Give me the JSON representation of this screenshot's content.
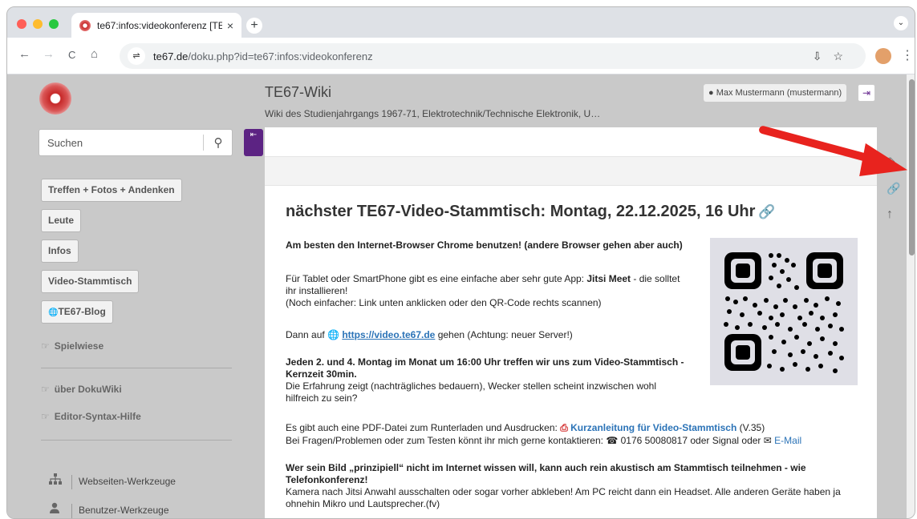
{
  "browser": {
    "tab_title": "te67:infos:videokonferenz [TE67-Wiki]",
    "tab_close": "×",
    "new_tab": "+",
    "tab_menu": "⌄",
    "url_host": "te67.de",
    "url_path": "/doku.php?id=te67:infos:videokonferenz",
    "site_info_icon": "⇌",
    "back": "←",
    "forward": "→",
    "reload": "C",
    "home": "⌂",
    "omni_actions": "⇩☆",
    "menu": "⋮"
  },
  "sidebar": {
    "search_placeholder": "Suchen",
    "search_icon": "⚲",
    "collapse_icon": "⇤",
    "nav_buttons": [
      {
        "label": "Treffen + Fotos + Andenken"
      },
      {
        "label": "Leute"
      },
      {
        "label": "Infos"
      },
      {
        "label": "Video-Stammtisch"
      },
      {
        "label": "TE67-Blog",
        "icon": "🌐"
      }
    ],
    "links": [
      {
        "label": "Spielwiese",
        "icon": "☞"
      },
      {
        "label": "über DokuWiki",
        "icon": "☞"
      },
      {
        "label": "Editor-Syntax-Hilfe",
        "icon": "☞"
      }
    ],
    "tools": [
      {
        "label": "Webseiten-Werkzeuge",
        "icon": "sitemap-icon"
      },
      {
        "label": "Benutzer-Werkzeuge",
        "icon": "user-icon"
      }
    ]
  },
  "header": {
    "wiki_title": "TE67-Wiki",
    "wiki_subtitle": "Wiki des Studienjahrgangs 1967-71, Elektrotechnik/Technische Elektronik, U…",
    "user": "Max Mustermann (mustermann)",
    "user_icon": "●",
    "logout_icon": "⇥"
  },
  "content": {
    "heading": "nächster TE67-Video-Stammtisch: Montag, 22.12.2025, 16 Uhr",
    "permalink_icon": "🔗",
    "p1": "Am besten den Internet-Browser Chrome benutzen! (andere Browser gehen aber auch)",
    "p2a": "Für Tablet oder SmartPhone gibt es eine einfache aber sehr gute App: ",
    "p2b": "Jitsi Meet",
    "p2c": " - die solltet ihr installieren!",
    "p2d": "(Noch einfacher: Link unten anklicken oder den QR-Code rechts scannen)",
    "p3a": "Dann auf ",
    "p3_link": "https://video.te67.de",
    "p3b": " gehen (Achtung: neuer Server!)",
    "p4a": "Jeden 2. und 4. Montag im Monat um 16:00 Uhr treffen wir uns zum Video-Stammtisch - Kernzeit 30min.",
    "p4b": "Die Erfahrung zeigt (nachträgliches bedauern), Wecker stellen scheint inzwischen wohl hilfreich zu sein?",
    "p5a": "Es gibt auch eine PDF-Datei zum Runterladen und Ausdrucken: ",
    "p5_link": "Kurzanleitung für Video-Stammtisch",
    "p5b": " (V.35)",
    "p6a": "Bei Fragen/Problemen oder zum Testen könnt ihr mich gerne kontaktieren: ☎ 0176 50080817 oder Signal oder ",
    "p6_link": "E-Mail",
    "p7a": "Wer sein Bild „prinzipiell“ nicht im Internet wissen will, kann auch rein akustisch am Stammtisch teilnehmen - wie Telefonkonferenz!",
    "p7b": "Kamera nach Jitsi Anwahl ausschalten oder sogar vorher abkleben! Am PC reicht dann ein Headset. Alle anderen Geräte haben ja ohnehin Mikro und Lautsprecher.(fv)"
  },
  "page_tools": {
    "edit_icon": "✎",
    "link_icon": "🔗",
    "top_icon": "↑"
  },
  "colors": {
    "accent_purple": "#5c2383",
    "link_blue": "#2b73b7",
    "annotation_red": "#e8231e"
  }
}
